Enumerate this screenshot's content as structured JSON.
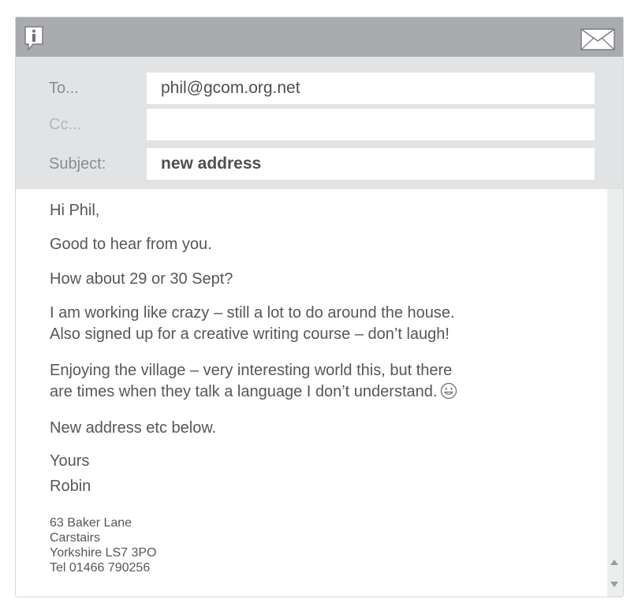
{
  "email": {
    "fields": {
      "to_label": "To...",
      "to_value": "phil@gcom.org.net",
      "cc_label": "Cc...",
      "cc_value": "",
      "subject_label": "Subject:",
      "subject_value": "new address"
    },
    "body": {
      "greeting": "Hi Phil,",
      "line1": "Good to hear from you.",
      "line2": "How about 29 or 30 Sept?",
      "para3_line1": "I am working like crazy – still a lot to do around the house.",
      "para3_line2": "Also signed up for a creative writing course – don’t laugh!",
      "para4_line1": "Enjoying the village – very interesting world this, but there",
      "para4_line2": "are times when they talk a language I don’t understand.",
      "line5": "New address etc below.",
      "closing": "Yours",
      "signature": "Robin"
    },
    "address": {
      "line1": "63 Baker Lane",
      "line2": "Carstairs",
      "line3": "Yorkshire LS7 3PO",
      "line4": "Tel 01466 790256"
    }
  },
  "icons": {
    "info": "info-icon",
    "mail": "envelope-icon",
    "smiley": "smiley-icon",
    "scroll_up": "scroll-up-arrow-icon",
    "scroll_down": "scroll-down-arrow-icon"
  },
  "colors": {
    "titlebar": "#a9abae",
    "window_bg": "#e2e3e5",
    "text": "#55575a",
    "label": "#8a8d90"
  }
}
